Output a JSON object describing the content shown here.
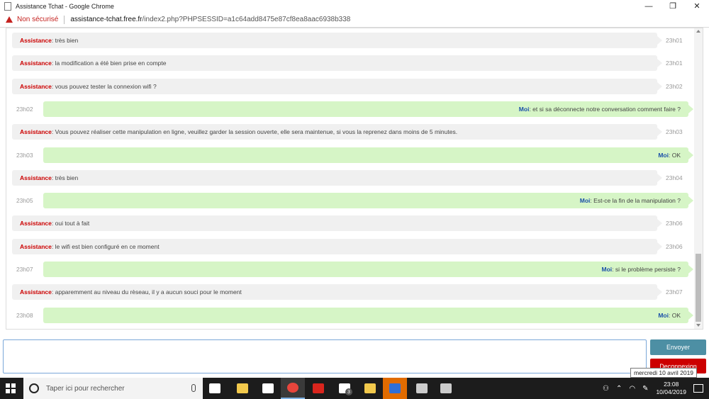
{
  "window": {
    "title": "Assistance Tchat - Google Chrome",
    "minimize": "—",
    "maximize": "❐",
    "close": "✕"
  },
  "address": {
    "security_label": "Non sécurisé",
    "url_host": "assistance-tchat.free.fr",
    "url_path": "/index2.php?PHPSESSID=a1c64add8475e87cf8ea8aac6938b338"
  },
  "messages": [
    {
      "from": "support",
      "sender": "Assistance",
      "text": ": très bien",
      "time": "23h01"
    },
    {
      "from": "support",
      "sender": "Assistance",
      "text": ": la modification a été bien prise en compte",
      "time": "23h01"
    },
    {
      "from": "support",
      "sender": "Assistance",
      "text": ": vous pouvez tester la connexion wifi ?",
      "time": "23h02"
    },
    {
      "from": "me",
      "sender": "Moi",
      "text": ": et si sa déconnecte notre conversation comment faire ?",
      "time": "23h02"
    },
    {
      "from": "support",
      "sender": "Assistance",
      "text": ": Vous pouvez réaliser cette manipulation en ligne, veuillez garder la session ouverte, elle sera maintenue, si vous la reprenez dans moins de 5 minutes.",
      "time": "23h03"
    },
    {
      "from": "me",
      "sender": "Moi",
      "text": ": OK",
      "time": "23h03"
    },
    {
      "from": "support",
      "sender": "Assistance",
      "text": ": très bien",
      "time": "23h04"
    },
    {
      "from": "me",
      "sender": "Moi",
      "text": ": Est-ce la fin de la manipulation ?",
      "time": "23h05"
    },
    {
      "from": "support",
      "sender": "Assistance",
      "text": ": oui tout à fait",
      "time": "23h06"
    },
    {
      "from": "support",
      "sender": "Assistance",
      "text": ": le wifi est bien configuré en ce moment",
      "time": "23h06"
    },
    {
      "from": "me",
      "sender": "Moi",
      "text": ": si le problème persiste ?",
      "time": "23h07"
    },
    {
      "from": "support",
      "sender": "Assistance",
      "text": ": apparemment au niveau du rèseau, il y a aucun souci pour le moment",
      "time": "23h07"
    },
    {
      "from": "me",
      "sender": "Moi",
      "text": ": OK",
      "time": "23h08"
    }
  ],
  "composer": {
    "value": "",
    "send_label": "Envoyer",
    "logout_label": "Deconnexion"
  },
  "tooltip": "mercredi 10 avril 2019",
  "taskbar": {
    "search_placeholder": "Taper ici pour rechercher",
    "apps": [
      {
        "name": "task-view",
        "color": "#ffffff"
      },
      {
        "name": "file-explorer",
        "color": "#f2c94c"
      },
      {
        "name": "store",
        "color": "#ffffff"
      },
      {
        "name": "chrome",
        "color": "#e8453c"
      },
      {
        "name": "pdf-reader",
        "color": "#d9251d"
      },
      {
        "name": "mail",
        "color": "#ffffff",
        "badge": "3"
      },
      {
        "name": "network-app",
        "color": "#f2c94c"
      },
      {
        "name": "shield-app",
        "color": "#2f6fd6"
      },
      {
        "name": "network-drive-1",
        "color": "#cccccc"
      },
      {
        "name": "network-drive-2",
        "color": "#cccccc"
      }
    ],
    "clock_time": "23:08",
    "clock_date": "10/04/2019"
  }
}
